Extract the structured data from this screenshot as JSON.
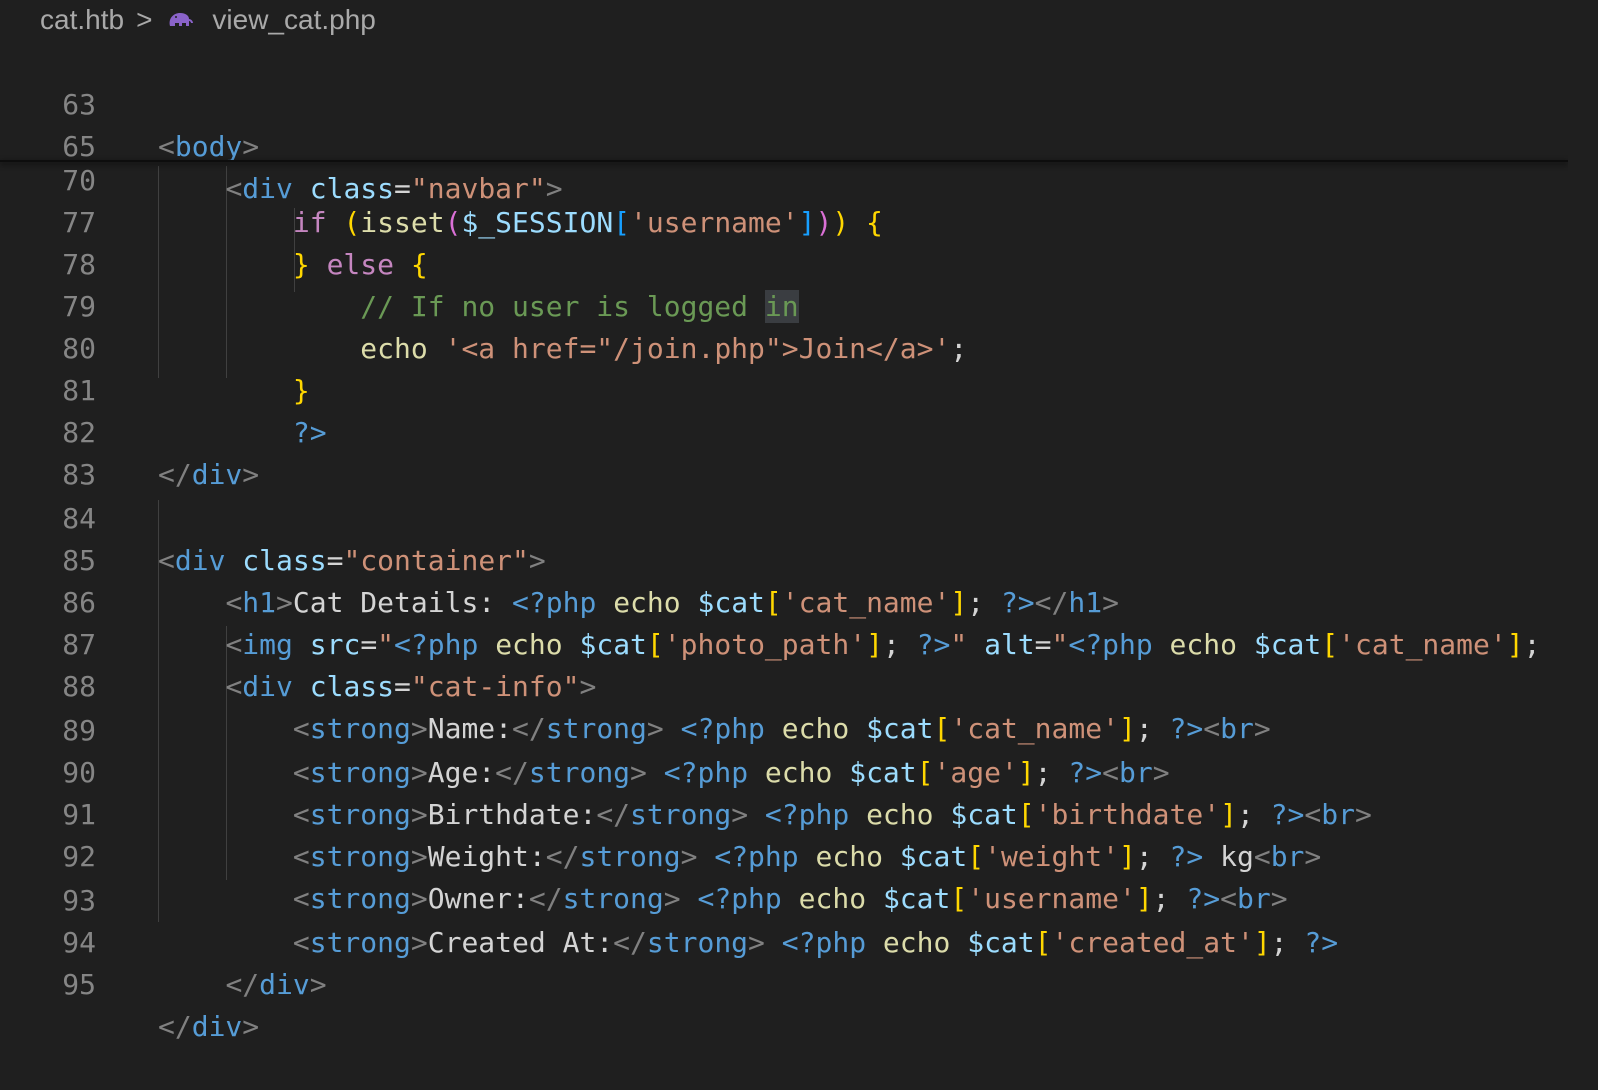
{
  "breadcrumb": {
    "root": "cat.htb",
    "separator": ">",
    "file_icon": "php-elephant-icon",
    "file": "view_cat.php"
  },
  "lines": [
    {
      "num": "63",
      "code": "<body>"
    },
    {
      "num": "65",
      "code": "    <div class=\"navbar\">"
    },
    {
      "num": "70",
      "code": "        if (isset($_SESSION['username'])) {"
    },
    {
      "num": "77",
      "code": "        } else {"
    },
    {
      "num": "78",
      "code": "            // If no user is logged in"
    },
    {
      "num": "79",
      "code": "            echo '<a href=\"/join.php\">Join</a>';"
    },
    {
      "num": "80",
      "code": "        }"
    },
    {
      "num": "81",
      "code": "        ?>"
    },
    {
      "num": "82",
      "code": "</div>"
    },
    {
      "num": "83",
      "code": ""
    },
    {
      "num": "84",
      "code": "<div class=\"container\">"
    },
    {
      "num": "85",
      "code": "    <h1>Cat Details: <?php echo $cat['cat_name']; ?></h1>"
    },
    {
      "num": "86",
      "code": "    <img src=\"<?php echo $cat['photo_path']; ?>\" alt=\"<?php echo $cat['cat_name'];"
    },
    {
      "num": "87",
      "code": "    <div class=\"cat-info\">"
    },
    {
      "num": "88",
      "code": "        <strong>Name:</strong> <?php echo $cat['cat_name']; ?><br>"
    },
    {
      "num": "89",
      "code": "        <strong>Age:</strong> <?php echo $cat['age']; ?><br>"
    },
    {
      "num": "90",
      "code": "        <strong>Birthdate:</strong> <?php echo $cat['birthdate']; ?><br>"
    },
    {
      "num": "91",
      "code": "        <strong>Weight:</strong> <?php echo $cat['weight']; ?> kg<br>"
    },
    {
      "num": "92",
      "code": "        <strong>Owner:</strong> <?php echo $cat['username']; ?><br>"
    },
    {
      "num": "93",
      "code": "        <strong>Created At:</strong> <?php echo $cat['created_at']; ?>"
    },
    {
      "num": "94",
      "code": "    </div>"
    },
    {
      "num": "95",
      "code": "</div>"
    }
  ],
  "highlighted_word": "in",
  "colors": {
    "background": "#1f1f1f",
    "line_number": "#858585",
    "tag": "#569cd6",
    "attribute": "#9cdcfe",
    "string": "#ce9178",
    "keyword": "#c586c0",
    "function": "#dcdcaa",
    "comment": "#6a9955",
    "bracket_1": "#ffd700",
    "bracket_2": "#da70d6",
    "bracket_3": "#179fff"
  }
}
